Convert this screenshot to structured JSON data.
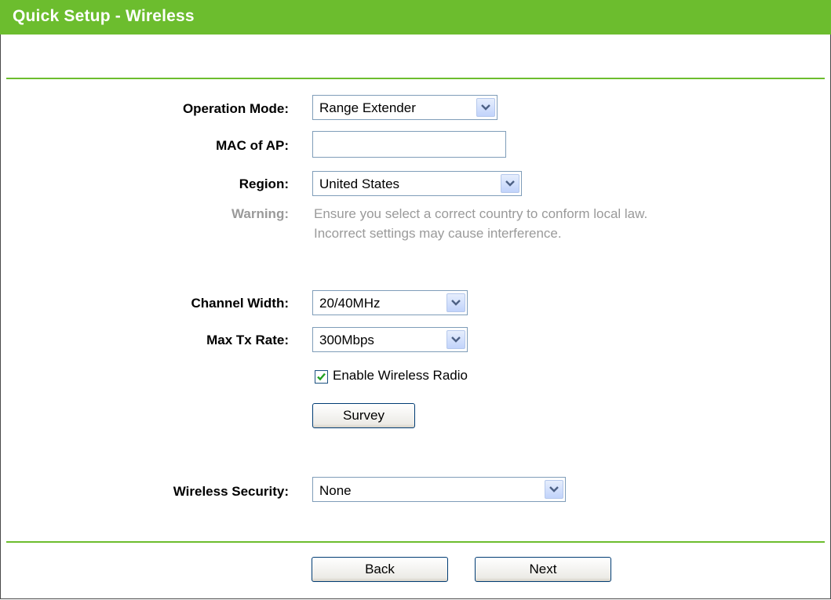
{
  "header": {
    "title": "Quick Setup - Wireless"
  },
  "form": {
    "operation_mode": {
      "label": "Operation Mode:",
      "value": "Range Extender"
    },
    "mac_of_ap": {
      "label": "MAC of AP:",
      "value": ""
    },
    "region": {
      "label": "Region:",
      "value": "United States"
    },
    "warning": {
      "label": "Warning:",
      "line1": "Ensure you select a correct country to conform local law.",
      "line2": "Incorrect settings may cause interference."
    },
    "channel_width": {
      "label": "Channel Width:",
      "value": "20/40MHz"
    },
    "max_tx_rate": {
      "label": "Max Tx Rate:",
      "value": "300Mbps"
    },
    "enable_radio": {
      "label": "Enable Wireless Radio",
      "checked": true
    },
    "survey_button": "Survey",
    "wireless_security": {
      "label": "Wireless Security:",
      "value": "None"
    }
  },
  "footer": {
    "back_label": "Back",
    "next_label": "Next"
  },
  "colors": {
    "header_green": "#6cbd2e",
    "warning_gray": "#9a9a9a",
    "input_border": "#7f9db9"
  },
  "icons": {
    "dropdown": "chevron-down-icon",
    "checkbox": "checkmark-icon"
  }
}
